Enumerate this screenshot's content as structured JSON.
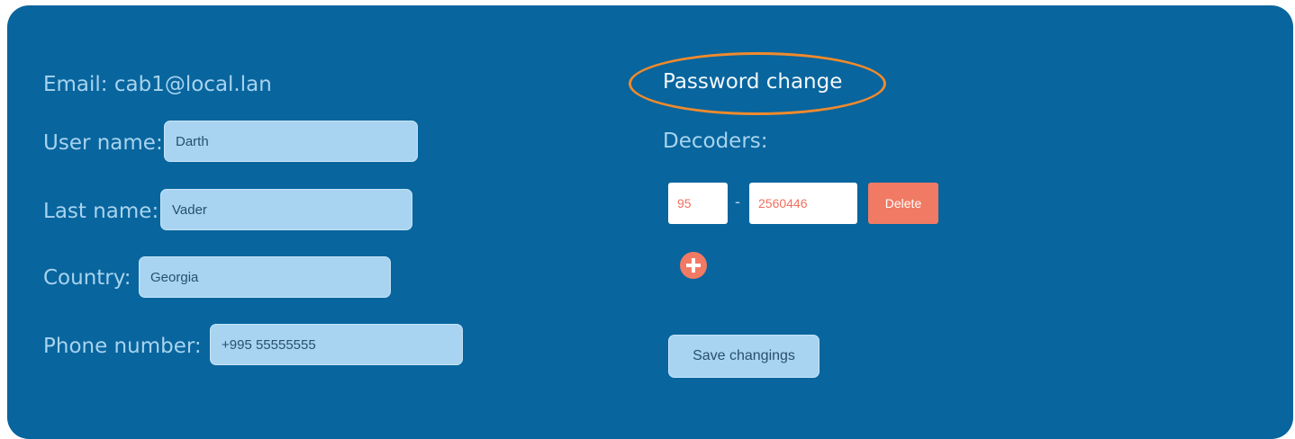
{
  "profile": {
    "email_label": "Email: cab1@local.lan",
    "username_label": "User name:",
    "username_value": "Darth",
    "lastname_label": "Last name:",
    "lastname_value": "Vader",
    "country_label": "Country:",
    "country_value": "Georgia",
    "phone_label": "Phone number:",
    "phone_value": "+995 55555555"
  },
  "right": {
    "password_change_label": "Password change",
    "decoders_label": "Decoders:",
    "decoders": [
      {
        "prefix": "95",
        "separator": "-",
        "number": "2560446",
        "delete_label": "Delete"
      }
    ],
    "add_icon": "plus-circle-icon",
    "save_label": "Save changings"
  },
  "colors": {
    "panel_bg": "#08659e",
    "field_bg": "#a8d4f1",
    "accent": "#f07a63",
    "highlight": "#f08a2c"
  }
}
